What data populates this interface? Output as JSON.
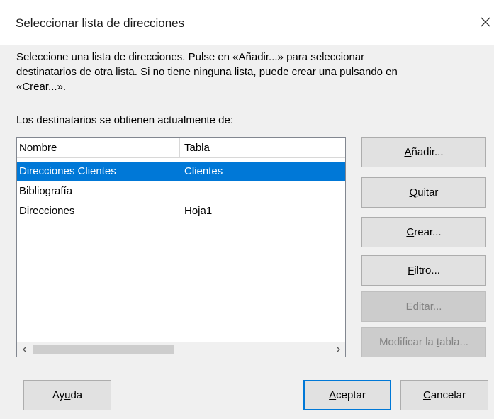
{
  "dialog": {
    "title": "Seleccionar lista de direcciones",
    "description": "Seleccione una lista de direcciones. Pulse en «Añadir...» para seleccionar\ndestinatarios de otra lista. Si no tiene ninguna lista, puede crear una pulsando en\n«Crear...».",
    "current_source_label": "Los destinatarios se obtienen actualmente de:"
  },
  "list": {
    "columns": {
      "name": "Nombre",
      "table": "Tabla"
    },
    "rows": [
      {
        "name": "Direcciones Clientes",
        "table": "Clientes",
        "selected": true
      },
      {
        "name": "Bibliografía",
        "table": "",
        "selected": false
      },
      {
        "name": "Direcciones",
        "table": "Hoja1",
        "selected": false
      }
    ]
  },
  "buttons": {
    "add": {
      "pre": "",
      "mn": "A",
      "post": "ñadir..."
    },
    "remove": {
      "pre": "",
      "mn": "Q",
      "post": "uitar"
    },
    "create": {
      "pre": "",
      "mn": "C",
      "post": "rear..."
    },
    "filter": {
      "pre": "",
      "mn": "F",
      "post": "iltro..."
    },
    "edit": {
      "pre": "",
      "mn": "E",
      "post": "ditar..."
    },
    "modify_table": {
      "pre": "Modificar la ",
      "mn": "t",
      "post": "abla..."
    },
    "help": {
      "pre": "Ay",
      "mn": "u",
      "post": "da"
    },
    "ok": {
      "pre": "",
      "mn": "A",
      "post": "ceptar"
    },
    "cancel": {
      "pre": "",
      "mn": "C",
      "post": "ancelar"
    }
  },
  "colors": {
    "selection": "#0078d7",
    "default_button_border": "#0078d7"
  }
}
